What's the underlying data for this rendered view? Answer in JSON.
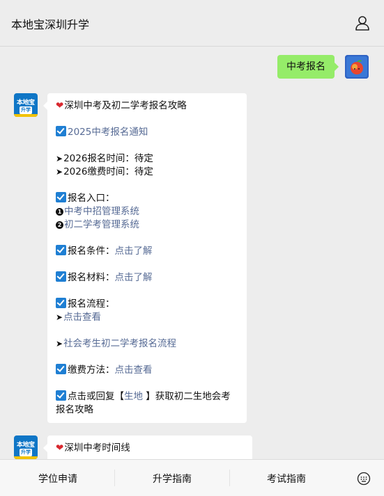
{
  "header": {
    "title": "本地宝深圳升学",
    "user_icon": "user-icon"
  },
  "chat": {
    "user_message": "中考报名",
    "card1": {
      "title": "深圳中考及初二学考报名攻略",
      "notice_link": "2025中考报名通知",
      "reg_time": "2026报名时间：待定",
      "pay_time": "2026缴费时间：待定",
      "entry_label": "报名入口：",
      "entry1_link": "中考中招管理系统",
      "entry2_link": "初二学考管理系统",
      "cond_label": "报名条件：",
      "cond_link": "点击了解",
      "material_label": "报名材料：",
      "material_link": "点击了解",
      "process_label": "报名流程：",
      "process_link": "点击查看",
      "social_link": "社会考生初二学考报名流程",
      "pay_label": "缴费方法：",
      "pay_link": "点击查看",
      "reply_prefix": "点击或回复【",
      "reply_keyword": "生地",
      "reply_suffix": " 】获取初二生地会考",
      "reply_suffix2": "报名攻略"
    },
    "card2": {
      "title": "深圳中考时间线"
    },
    "bot_avatar": {
      "line1": "本地宝",
      "line2": "升学"
    }
  },
  "footer": {
    "tabs": [
      "学位申请",
      "升学指南",
      "考试指南"
    ],
    "keyboard_icon": "keyboard-icon"
  },
  "colors": {
    "background": "#ededed",
    "user_bubble": "#95ec69",
    "link": "#576b95",
    "checkbox": "#1f7fd3",
    "heart": "#d8282f"
  }
}
